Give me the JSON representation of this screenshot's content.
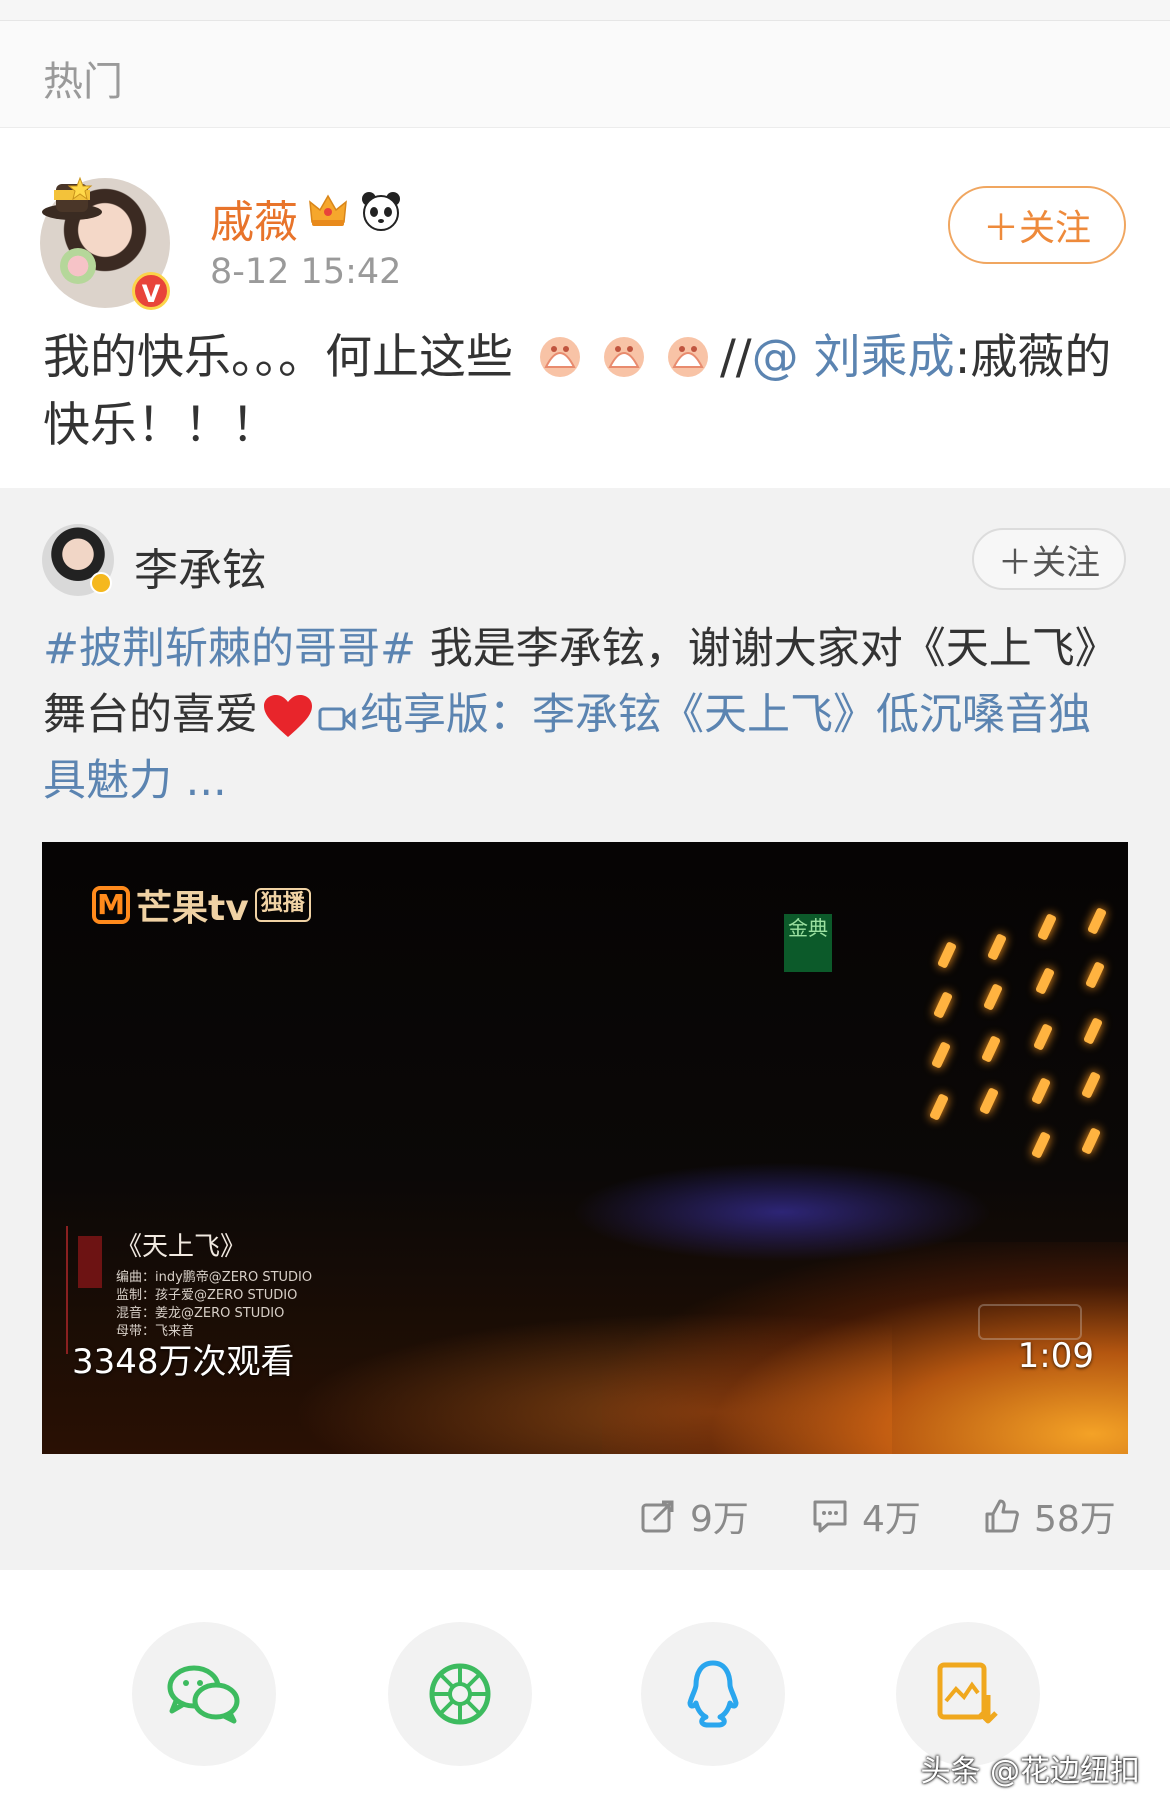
{
  "section": {
    "label": "热门"
  },
  "post": {
    "author": "戚薇",
    "time": "8-12 15:42",
    "follow_label": "＋关注",
    "text_before": "我的快乐。。。何止这些",
    "repost_prefix": "//",
    "mention": "@ 刘乘成",
    "text_after": ":戚薇的快乐！！！",
    "emoji_count": 3,
    "badges": [
      "crown-icon",
      "panda-icon"
    ]
  },
  "repost": {
    "author": "李承铉",
    "follow_label": "＋关注",
    "hashtag": "#披荆斩棘的哥哥#",
    "text": " 我是李承铉，谢谢大家对《天上飞》舞台的喜爱",
    "video_link": "纯享版：李承铉《天上飞》低沉嗓音独具魅力 ...",
    "video": {
      "platform": "芒果tv",
      "exclusive": "独播",
      "sign": "金典",
      "song_title": "《天上飞》",
      "credits": [
        "编曲：indy鹏帝@ZERO STUDIO",
        "监制：孩子爱@ZERO STUDIO",
        "混音：姜龙@ZERO STUDIO",
        "母带：飞来音"
      ],
      "views": "3348万次观看",
      "duration": "1:09"
    },
    "stats": {
      "reposts": "9万",
      "comments": "4万",
      "likes": "58万"
    }
  },
  "share": {
    "targets": [
      "wechat-icon",
      "moments-icon",
      "qq-icon",
      "save-image-icon"
    ]
  },
  "watermark": "头条 @花边纽扣",
  "colors": {
    "accent_orange": "#ee8a3b",
    "link_blue": "#5b84b1",
    "stat_gray": "#8a8a8a"
  }
}
